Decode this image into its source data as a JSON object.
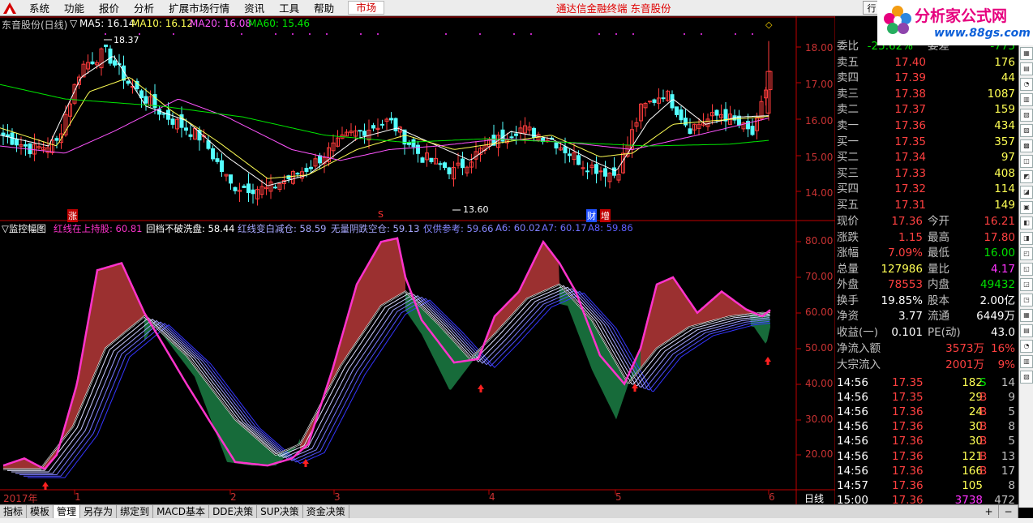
{
  "menu": {
    "items": [
      "系统",
      "功能",
      "报价",
      "分析",
      "扩展市场行情",
      "资讯",
      "工具",
      "帮助"
    ],
    "market_tab": "市场",
    "title": "通达信金融终端  东音股份",
    "restore": "行"
  },
  "watermark": {
    "brand": "分析家公式网",
    "url": "www.88gs.com"
  },
  "price_header": {
    "name": "东音股份(日线)",
    "ma5": "MA5: 16.14",
    "ma10": "MA10: 16.12",
    "ma20": "MA20: 16.08",
    "ma60": "MA60: 15.46"
  },
  "ind_header": {
    "name": "监控幅图",
    "l1": "红线在上持股: 60.81",
    "l2": "回档不破洗盘: 58.44",
    "l3": "红线变白减仓: 58.59",
    "l4": "无量阴跌空仓: 59.13",
    "l5": "仅供参考: 59.66",
    "l6": "A6: 60.02",
    "l7": "A7: 60.17",
    "l8": "A8: 59.86"
  },
  "price_axis": [
    "18.00",
    "17.00",
    "16.00",
    "15.00",
    "14.00"
  ],
  "ind_axis": [
    "80.00",
    "70.00",
    "60.00",
    "50.00",
    "40.00",
    "30.00",
    "20.00"
  ],
  "time_axis": {
    "year": "2017年",
    "months": [
      "1",
      "2",
      "3",
      "4",
      "5",
      "6"
    ],
    "period": "日线"
  },
  "annotations": {
    "high": "18.37",
    "low": "13.60",
    "zhang": "涨",
    "s": "S",
    "cai": "财",
    "zeng": "增"
  },
  "colors": {
    "up": "#ff3c3c",
    "down": "#54ffff",
    "ma5": "#ffffff",
    "ma10": "#ffff54",
    "ma20": "#ff54ff",
    "ma60": "#00e800",
    "pink": "#ff33cc",
    "red_fill": "#9b3030",
    "green_fill": "#176b3a",
    "axis": "#c00000"
  },
  "chart_data": {
    "type": "line",
    "title": "",
    "xlabel": "",
    "ylabel": "",
    "price_ylim": [
      13.4,
      18.9
    ],
    "x": [
      "2016-12-01",
      "2017-01-03",
      "2017-02-03",
      "2017-03-01",
      "2017-04-05",
      "2017-05-02",
      "2017-06-01"
    ],
    "series": [
      {
        "name": "MA5",
        "values": [
          15.7,
          17.6,
          15.2,
          15.3,
          15.3,
          14.7,
          16.14
        ]
      },
      {
        "name": "MA10",
        "values": [
          15.6,
          17.3,
          15.8,
          15.1,
          15.4,
          14.5,
          16.12
        ]
      },
      {
        "name": "MA20",
        "values": [
          15.2,
          16.0,
          16.2,
          15.2,
          15.3,
          15.2,
          16.08
        ]
      },
      {
        "name": "MA60",
        "values": [
          16.3,
          16.6,
          16.2,
          15.8,
          15.6,
          15.3,
          15.46
        ]
      }
    ],
    "indicator_ylim": [
      12,
      84
    ],
    "indicator_series": [
      {
        "name": "红线在上持股",
        "values": [
          16,
          73,
          18,
          81,
          37,
          81,
          20,
          67,
          60.81
        ]
      },
      {
        "name": "A8",
        "values": [
          15,
          60,
          22,
          64,
          42,
          68,
          23,
          56,
          59.86
        ]
      }
    ],
    "buy_markers": [
      "2017-01",
      "2017-02",
      "2017-03",
      "2017-04",
      "2017-05",
      "2017-06"
    ]
  },
  "quote": {
    "rows": [
      {
        "k": "委比",
        "v": "-25.62%",
        "k2": "委差",
        "v2": "-775"
      },
      {
        "k": "卖五",
        "v": "17.40",
        "v2": "176"
      },
      {
        "k": "卖四",
        "v": "17.39",
        "v2": "44"
      },
      {
        "k": "卖三",
        "v": "17.38",
        "v2": "1087"
      },
      {
        "k": "卖二",
        "v": "17.37",
        "v2": "159"
      },
      {
        "k": "卖一",
        "v": "17.36",
        "v2": "434"
      },
      {
        "k": "买一",
        "v": "17.35",
        "v2": "357"
      },
      {
        "k": "买二",
        "v": "17.34",
        "v2": "97"
      },
      {
        "k": "买三",
        "v": "17.33",
        "v2": "408"
      },
      {
        "k": "买四",
        "v": "17.32",
        "v2": "114"
      },
      {
        "k": "买五",
        "v": "17.31",
        "v2": "149"
      }
    ],
    "stats": [
      {
        "k": "现价",
        "v": "17.36",
        "k2": "今开",
        "v2": "16.21"
      },
      {
        "k": "涨跌",
        "v": "1.15",
        "k2": "最高",
        "v2": "17.80"
      },
      {
        "k": "涨幅",
        "v": "7.09%",
        "k2": "最低",
        "v2": "16.00"
      },
      {
        "k": "总量",
        "v": "127986",
        "k2": "量比",
        "v2": "4.17"
      },
      {
        "k": "外盘",
        "v": "78553",
        "k2": "内盘",
        "v2": "49432"
      },
      {
        "k": "换手",
        "v": "19.85%",
        "k2": "股本",
        "v2": "2.00亿"
      },
      {
        "k": "净资",
        "v": "3.77",
        "k2": "流通",
        "v2": "6449万"
      },
      {
        "k": "收益(一)",
        "v": "0.101",
        "k2": "PE(动)",
        "v2": "43.0"
      }
    ],
    "flows": [
      {
        "k": "净流入额",
        "v": "3573万",
        "p": "16%"
      },
      {
        "k": "大宗流入",
        "v": "2001万",
        "p": "9%"
      }
    ],
    "ticks": [
      {
        "t": "14:56",
        "p": "17.35",
        "v": "182",
        "bs": "S",
        "n": "14"
      },
      {
        "t": "14:56",
        "p": "17.35",
        "v": "29",
        "bs": "B",
        "n": "9"
      },
      {
        "t": "14:56",
        "p": "17.36",
        "v": "24",
        "bs": "B",
        "n": "5"
      },
      {
        "t": "14:56",
        "p": "17.36",
        "v": "30",
        "bs": "B",
        "n": "8"
      },
      {
        "t": "14:56",
        "p": "17.36",
        "v": "30",
        "bs": "B",
        "n": "5"
      },
      {
        "t": "14:56",
        "p": "17.36",
        "v": "121",
        "bs": "B",
        "n": "13"
      },
      {
        "t": "14:56",
        "p": "17.36",
        "v": "166",
        "bs": "B",
        "n": "17"
      },
      {
        "t": "14:57",
        "p": "17.36",
        "v": "105",
        "bs": "",
        "n": "8"
      },
      {
        "t": "15:00",
        "p": "17.36",
        "v": "3738",
        "bs": "",
        "n": "472"
      }
    ]
  },
  "bottom_tabs": [
    "指标",
    "模板",
    "管理",
    "另存为",
    "绑定到",
    "MACD基本",
    "DDE决策",
    "SUP决策",
    "资金决策"
  ],
  "bottom_right": [
    "+",
    "−"
  ]
}
